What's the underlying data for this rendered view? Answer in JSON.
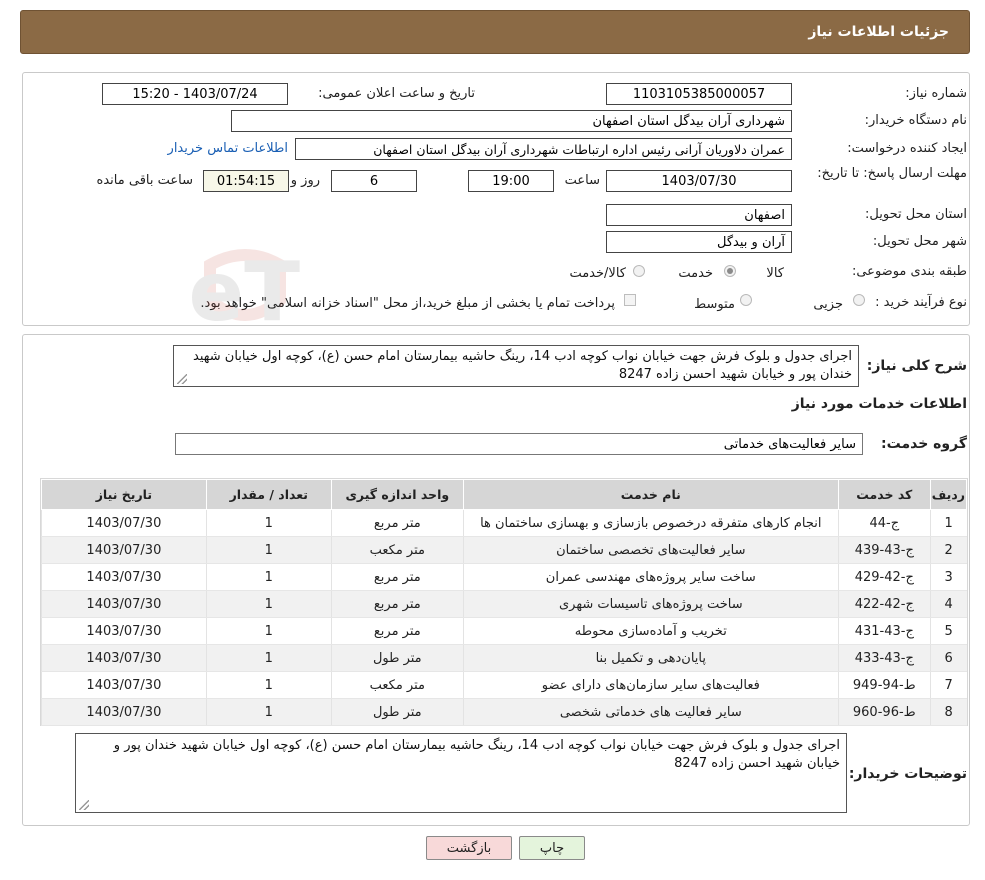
{
  "header": {
    "title": "جزئیات اطلاعات نیاز"
  },
  "info": {
    "need_number_label": "شماره نیاز:",
    "need_number": "1103105385000057",
    "announce_label": "تاریخ و ساعت اعلان عمومی:",
    "announce_value": "1403/07/24 - 15:20",
    "buyer_org_label": "نام دستگاه خریدار:",
    "buyer_org": "شهرداری آران بیدگل استان اصفهان",
    "requester_label": "ایجاد کننده درخواست:",
    "requester": "عمران دلاوریان آرانی رئیس اداره ارتباطات شهرداری آران بیدگل استان اصفهان",
    "contact_link": "اطلاعات تماس خریدار",
    "deadline_label": "مهلت ارسال پاسخ: تا تاریخ:",
    "deadline_date": "1403/07/30",
    "time_label": "ساعت",
    "deadline_time": "19:00",
    "days_value": "6",
    "days_label": "روز و",
    "remaining_time": "01:54:15",
    "remaining_label": "ساعت باقی مانده",
    "province_label": "استان محل تحویل:",
    "province": "اصفهان",
    "city_label": "شهر محل تحویل:",
    "city": "آران و بیدگل",
    "category_label": "طبقه بندی موضوعی:",
    "category_options": [
      "کالا",
      "خدمت",
      "کالا/خدمت"
    ],
    "category_selected": "کالا",
    "process_label": "نوع فرآیند خرید :",
    "process_options": [
      "جزیی",
      "متوسط"
    ],
    "process_note": "پرداخت تمام یا بخشی از مبلغ خرید،از محل \"اسناد خزانه اسلامی\" خواهد بود."
  },
  "summary": {
    "label": "شرح کلی نیاز:",
    "text": "اجرای جدول و بلوک فرش جهت خیابان نواب کوچه ادب 14، رینگ حاشیه بیمارستان امام حسن (ع)، کوچه اول خیابان شهید خندان پور و خیابان شهید احسن زاده 8247"
  },
  "services_section": {
    "title": "اطلاعات خدمات مورد نیاز",
    "group_label": "گروه خدمت:",
    "group_value": "سایر فعالیت‌های خدماتی"
  },
  "table": {
    "headers": [
      "ردیف",
      "کد خدمت",
      "نام خدمت",
      "واحد اندازه گیری",
      "تعداد / مقدار",
      "تاریخ نیاز"
    ],
    "rows": [
      [
        "1",
        "ج-44",
        "انجام کارهای متفرقه درخصوص بازسازی و بهسازی ساختمان ها",
        "متر مربع",
        "1",
        "1403/07/30"
      ],
      [
        "2",
        "ج-43-439",
        "سایر فعالیت‌های تخصصی ساختمان",
        "متر مکعب",
        "1",
        "1403/07/30"
      ],
      [
        "3",
        "ج-42-429",
        "ساخت سایر پروژه‌های مهندسی عمران",
        "متر مربع",
        "1",
        "1403/07/30"
      ],
      [
        "4",
        "ج-42-422",
        "ساخت پروژه‌های تاسیسات شهری",
        "متر مربع",
        "1",
        "1403/07/30"
      ],
      [
        "5",
        "ج-43-431",
        "تخریب و آماده‌سازی محوطه",
        "متر مربع",
        "1",
        "1403/07/30"
      ],
      [
        "6",
        "ج-43-433",
        "پایان‌دهی و تکمیل بنا",
        "متر طول",
        "1",
        "1403/07/30"
      ],
      [
        "7",
        "ط-94-949",
        "فعالیت‌های سایر سازمان‌های دارای عضو",
        "متر مکعب",
        "1",
        "1403/07/30"
      ],
      [
        "8",
        "ط-96-960",
        "سایر فعالیت های خدماتی شخصی",
        "متر طول",
        "1",
        "1403/07/30"
      ]
    ]
  },
  "buyer_notes": {
    "label": "توضیحات خریدار:",
    "text": "اجرای جدول و بلوک فرش جهت خیابان نواب کوچه ادب 14، رینگ حاشیه بیمارستان امام حسن (ع)، کوچه اول خیابان شهید خندان پور و خیابان شهید احسن زاده 8247"
  },
  "buttons": {
    "print": "چاپ",
    "back": "بازگشت"
  },
  "watermark": {
    "text": "AriaTender.neT"
  },
  "colors": {
    "header_bg": "#8b6a45",
    "back_button_bg": "#f8d9d9",
    "print_button_bg": "#e4f4dc",
    "link": "#1a5fb4"
  }
}
